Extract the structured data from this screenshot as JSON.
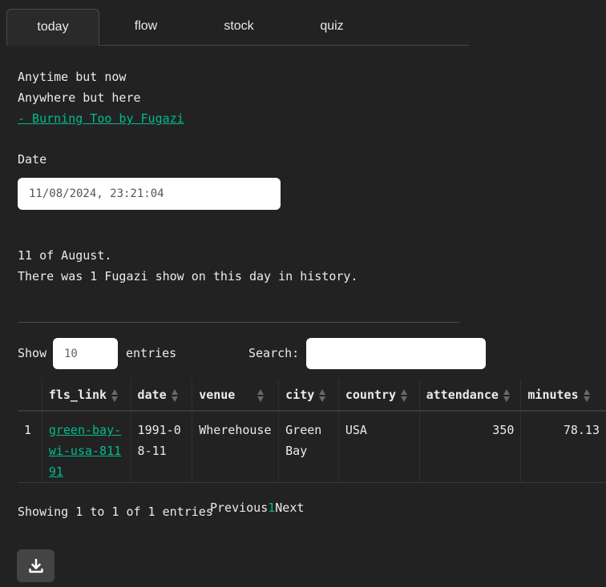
{
  "tabs": [
    {
      "label": "today",
      "active": true
    },
    {
      "label": "flow",
      "active": false
    },
    {
      "label": "stock",
      "active": false
    },
    {
      "label": "quiz",
      "active": false
    }
  ],
  "quote": {
    "line1": "Anytime but now",
    "line2": "Anywhere but here",
    "source": "- Burning Too by Fugazi"
  },
  "date_field": {
    "label": "Date",
    "value": "11/08/2024, 23:21:04"
  },
  "summary": {
    "line1": "11 of August.",
    "line2": "There was 1 Fugazi show on this day in history."
  },
  "table_controls": {
    "show_label": "Show",
    "length_value": "10",
    "entries_label": "entries",
    "search_label": "Search:",
    "search_value": ""
  },
  "table": {
    "headers": [
      "",
      "fls_link",
      "date",
      "venue",
      "city",
      "country",
      "attendance",
      "minutes"
    ],
    "rows": [
      {
        "index": "1",
        "fls_link": "green-bay-wi-usa-81191",
        "date": "1991-08-11",
        "venue": "Wherehouse",
        "city": "Green Bay",
        "country": "USA",
        "attendance": "350",
        "minutes": "78.13"
      }
    ]
  },
  "footer": {
    "info": "Showing 1 to 1 of 1 entries",
    "previous": "Previous",
    "current_page": "1",
    "next": "Next"
  },
  "download_button": {
    "icon": "download-icon"
  },
  "colors": {
    "background": "#222222",
    "link": "#00bc8c",
    "text": "#ebebeb"
  }
}
